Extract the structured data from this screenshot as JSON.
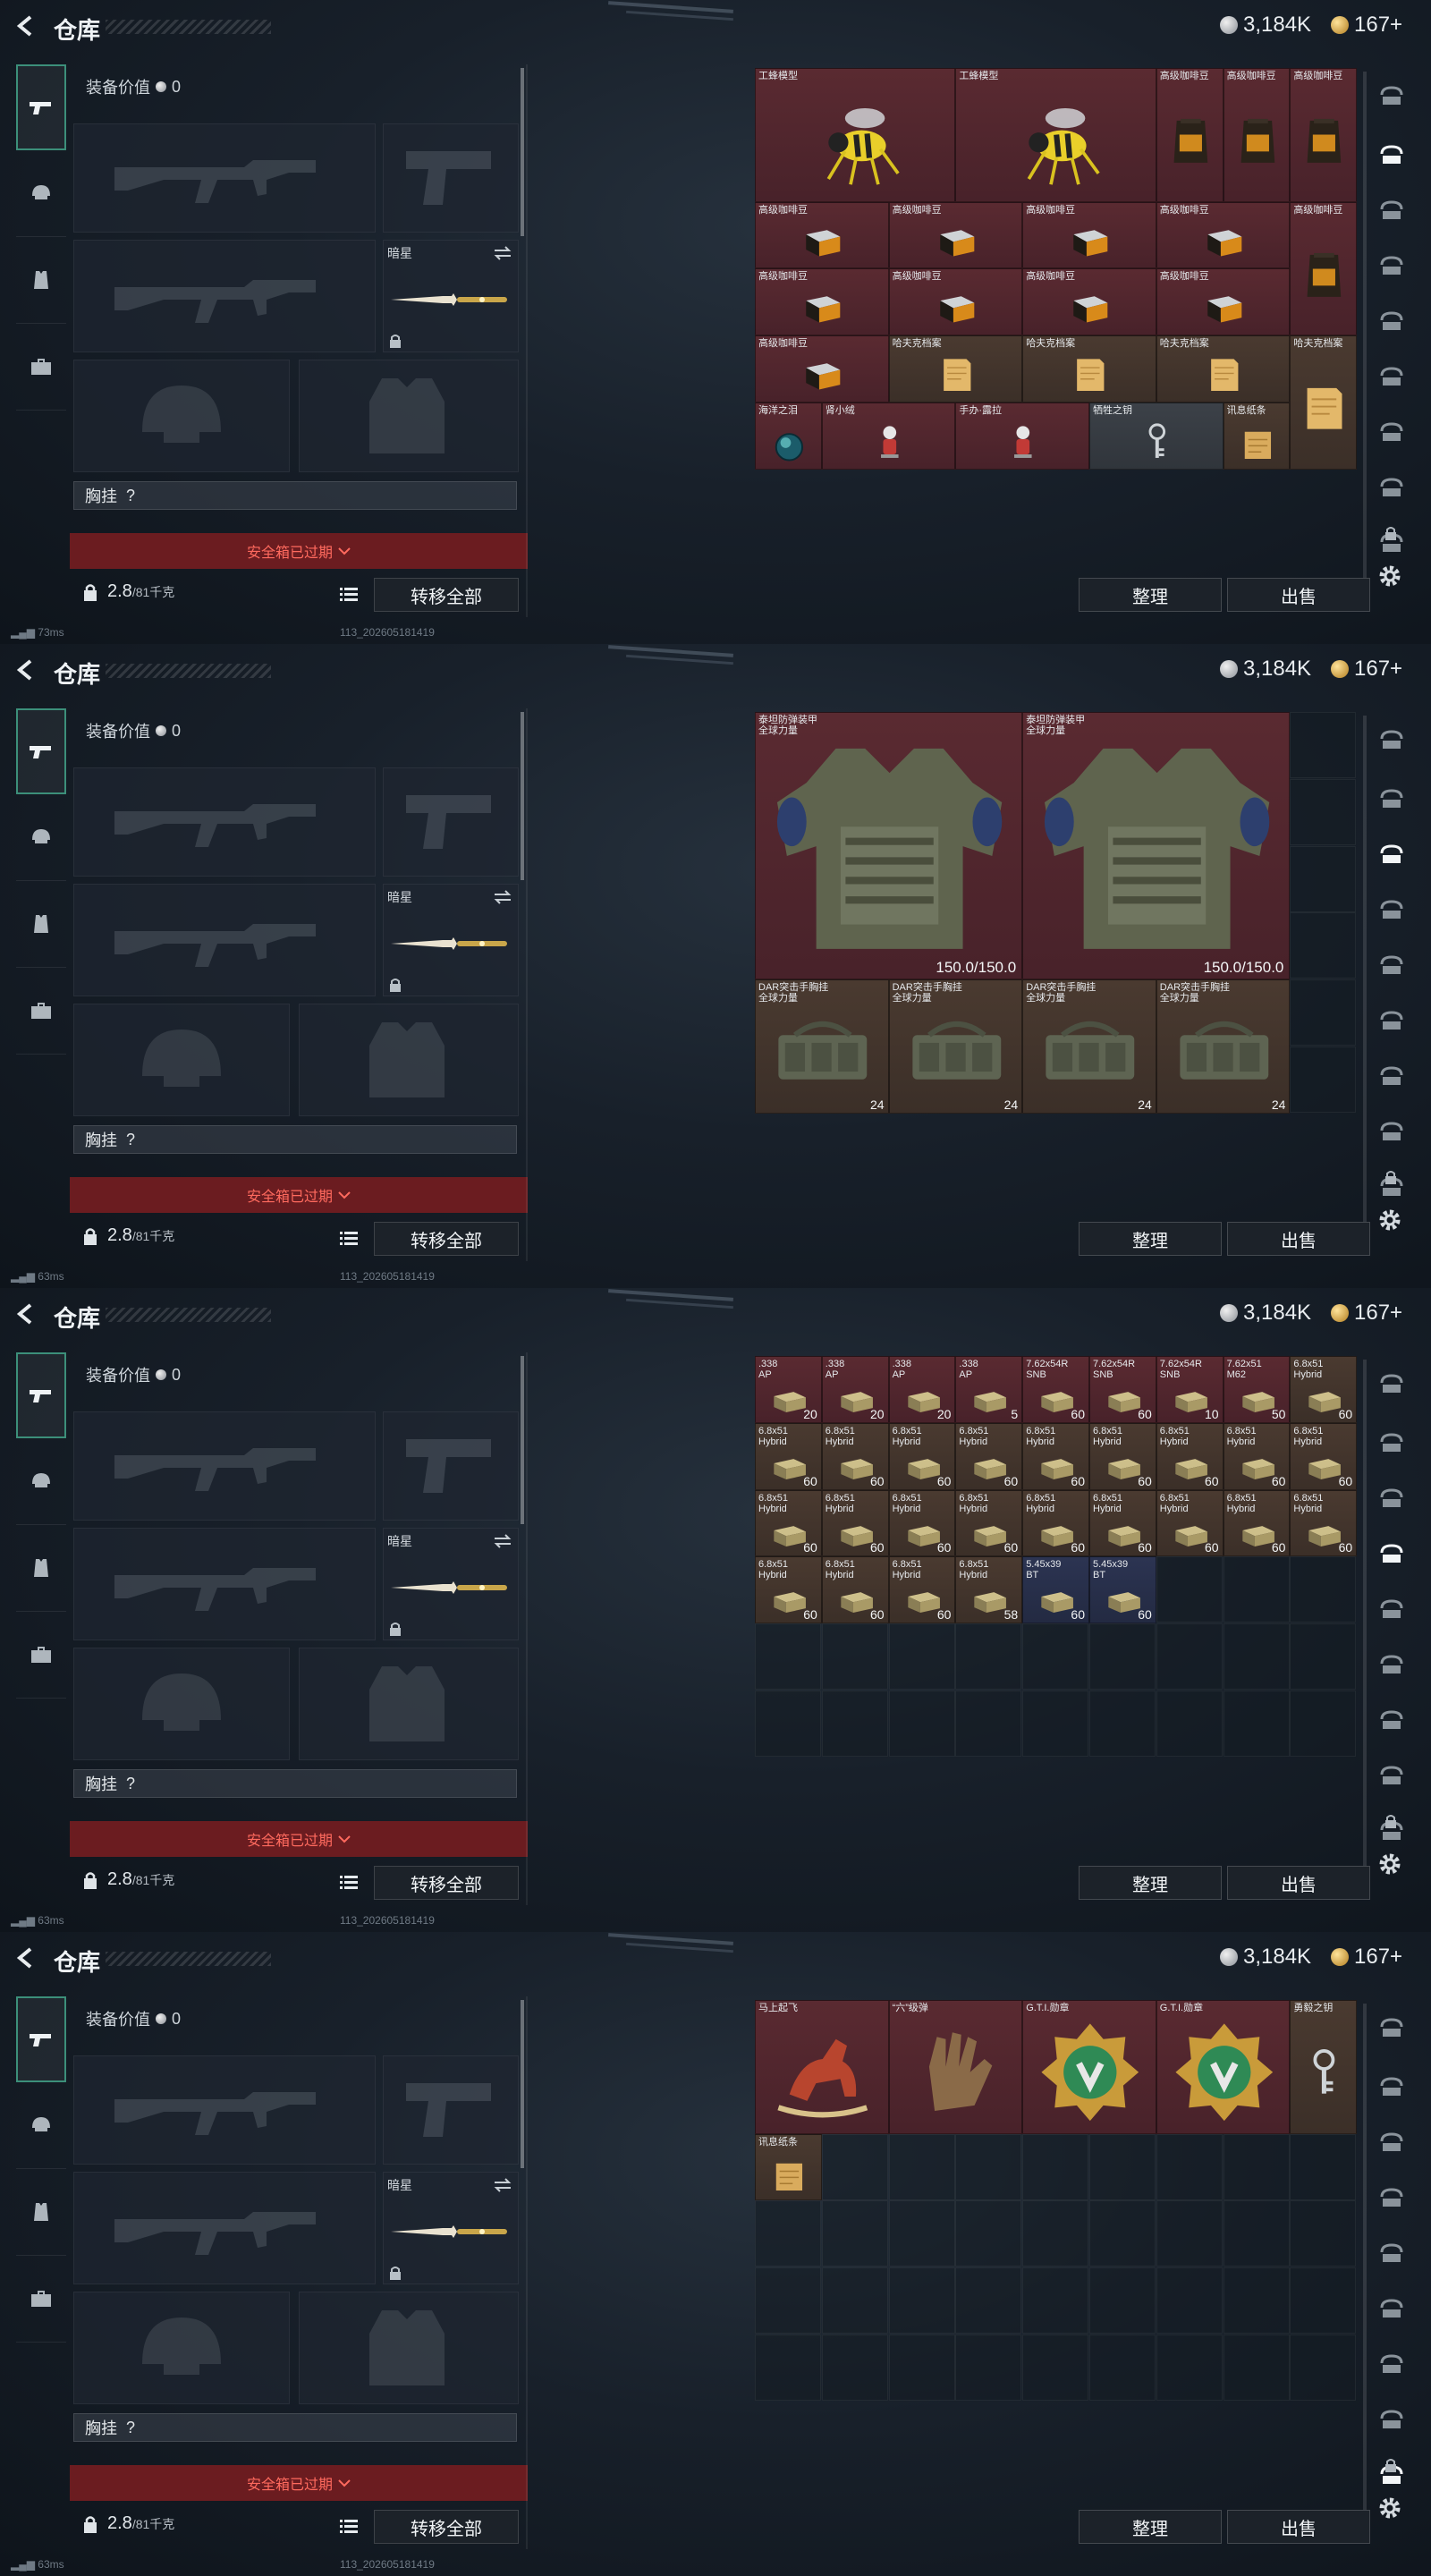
{
  "panels": [
    {
      "header": {
        "title": "仓库",
        "silver": "3,184K",
        "gold": "167+"
      },
      "equip": {
        "value_label": "装备价值",
        "value": "0",
        "secondary_slot_name": "暗星",
        "chest_label": "胸挂",
        "chest_hint": "?",
        "safebox_text": "安全箱已过期",
        "weight": "2.8",
        "weight_max": "/81千克",
        "transfer_label": "转移全部"
      },
      "status": {
        "ping": "73ms",
        "build": "113_202605181419"
      },
      "buttons": {
        "sort": "整理",
        "sell": "出售"
      }
    },
    {
      "header": {
        "title": "仓库",
        "silver": "3,184K",
        "gold": "167+"
      },
      "equip": {
        "value_label": "装备价值",
        "value": "0",
        "secondary_slot_name": "暗星",
        "chest_label": "胸挂",
        "chest_hint": "?",
        "safebox_text": "安全箱已过期",
        "weight": "2.8",
        "weight_max": "/81千克",
        "transfer_label": "转移全部"
      },
      "status": {
        "ping": "63ms",
        "build": "113_202605181419"
      },
      "buttons": {
        "sort": "整理",
        "sell": "出售"
      }
    },
    {
      "header": {
        "title": "仓库",
        "silver": "3,184K",
        "gold": "167+"
      },
      "equip": {
        "value_label": "装备价值",
        "value": "0",
        "secondary_slot_name": "暗星",
        "chest_label": "胸挂",
        "chest_hint": "?",
        "safebox_text": "安全箱已过期",
        "weight": "2.8",
        "weight_max": "/81千克",
        "transfer_label": "转移全部"
      },
      "status": {
        "ping": "63ms",
        "build": "113_202605181419"
      },
      "buttons": {
        "sort": "整理",
        "sell": "出售"
      }
    },
    {
      "header": {
        "title": "仓库",
        "silver": "3,184K",
        "gold": "167+"
      },
      "equip": {
        "value_label": "装备价值",
        "value": "0",
        "secondary_slot_name": "暗星",
        "chest_label": "胸挂",
        "chest_hint": "?",
        "safebox_text": "安全箱已过期",
        "weight": "2.8",
        "weight_max": "/81千克",
        "transfer_label": "转移全部"
      },
      "status": {
        "ping": "63ms",
        "build": "113_202605181419"
      },
      "buttons": {
        "sort": "整理",
        "sell": "出售"
      }
    }
  ],
  "storage": [
    {
      "items": [
        {
          "name": "工蜂模型",
          "r": 0,
          "c": 0,
          "w": 3,
          "h": 2,
          "bg": "red",
          "icon": "bee-model-icon"
        },
        {
          "name": "工蜂模型",
          "r": 0,
          "c": 3,
          "w": 3,
          "h": 2,
          "bg": "red",
          "icon": "bee-model-icon"
        },
        {
          "name": "高级咖啡豆",
          "r": 0,
          "c": 6,
          "w": 1,
          "h": 2,
          "bg": "red",
          "icon": "coffee-bag-icon"
        },
        {
          "name": "高级咖啡豆",
          "r": 0,
          "c": 7,
          "w": 1,
          "h": 2,
          "bg": "red",
          "icon": "coffee-bag-icon"
        },
        {
          "name": "高级咖啡豆",
          "r": 0,
          "c": 8,
          "w": 1,
          "h": 2,
          "bg": "red",
          "icon": "coffee-bag-icon"
        },
        {
          "name": "高级咖啡豆",
          "r": 2,
          "c": 0,
          "w": 2,
          "h": 1,
          "bg": "red",
          "icon": "coffee-box-icon"
        },
        {
          "name": "高级咖啡豆",
          "r": 2,
          "c": 2,
          "w": 2,
          "h": 1,
          "bg": "red",
          "icon": "coffee-box-icon"
        },
        {
          "name": "高级咖啡豆",
          "r": 2,
          "c": 4,
          "w": 2,
          "h": 1,
          "bg": "red",
          "icon": "coffee-box-icon"
        },
        {
          "name": "高级咖啡豆",
          "r": 2,
          "c": 6,
          "w": 2,
          "h": 1,
          "bg": "red",
          "icon": "coffee-box-icon"
        },
        {
          "name": "高级咖啡豆",
          "r": 2,
          "c": 8,
          "w": 1,
          "h": 2,
          "bg": "red",
          "icon": "coffee-bag-icon"
        },
        {
          "name": "高级咖啡豆",
          "r": 3,
          "c": 0,
          "w": 2,
          "h": 1,
          "bg": "red",
          "icon": "coffee-box-icon"
        },
        {
          "name": "高级咖啡豆",
          "r": 3,
          "c": 2,
          "w": 2,
          "h": 1,
          "bg": "red",
          "icon": "coffee-box-icon"
        },
        {
          "name": "高级咖啡豆",
          "r": 3,
          "c": 4,
          "w": 2,
          "h": 1,
          "bg": "red",
          "icon": "coffee-box-icon"
        },
        {
          "name": "高级咖啡豆",
          "r": 3,
          "c": 6,
          "w": 2,
          "h": 1,
          "bg": "red",
          "icon": "coffee-box-icon"
        },
        {
          "name": "高级咖啡豆",
          "r": 4,
          "c": 0,
          "w": 2,
          "h": 1,
          "bg": "red",
          "icon": "coffee-box-icon"
        },
        {
          "name": "哈夫克档案",
          "r": 4,
          "c": 2,
          "w": 2,
          "h": 1,
          "bg": "brown",
          "icon": "document-icon"
        },
        {
          "name": "哈夫克档案",
          "r": 4,
          "c": 4,
          "w": 2,
          "h": 1,
          "bg": "brown",
          "icon": "document-icon"
        },
        {
          "name": "哈夫克档案",
          "r": 4,
          "c": 6,
          "w": 2,
          "h": 1,
          "bg": "brown",
          "icon": "document-icon"
        },
        {
          "name": "哈夫克档案",
          "r": 4,
          "c": 8,
          "w": 1,
          "h": 2,
          "bg": "brown",
          "icon": "document-icon"
        },
        {
          "name": "海洋之泪",
          "r": 5,
          "c": 0,
          "w": 1,
          "h": 1,
          "bg": "red",
          "icon": "orb-icon"
        },
        {
          "name": "肾小绒",
          "r": 5,
          "c": 1,
          "w": 2,
          "h": 1,
          "bg": "red",
          "icon": "figure-icon"
        },
        {
          "name": "手办·露拉",
          "r": 5,
          "c": 3,
          "w": 2,
          "h": 1,
          "bg": "red",
          "icon": "figure-icon"
        },
        {
          "name": "牺牲之钥",
          "r": 5,
          "c": 5,
          "w": 2,
          "h": 1,
          "bg": "gray",
          "icon": "key-icon"
        },
        {
          "name": "讯息纸条",
          "r": 5,
          "c": 7,
          "w": 1,
          "h": 1,
          "bg": "brown",
          "icon": "note-icon"
        }
      ]
    },
    {
      "items": [
        {
          "name": "泰坦防弹装甲\n全球力量",
          "r": 0,
          "c": 0,
          "w": 4,
          "h": 4,
          "bg": "red",
          "icon": "armor-icon",
          "durability": "150.0/150.0"
        },
        {
          "name": "泰坦防弹装甲\n全球力量",
          "r": 0,
          "c": 4,
          "w": 4,
          "h": 4,
          "bg": "red",
          "icon": "armor-icon",
          "durability": "150.0/150.0"
        },
        {
          "name": "DAR突击手胸挂\n全球力量",
          "r": 4,
          "c": 0,
          "w": 2,
          "h": 2,
          "bg": "brown",
          "icon": "chest-rig-icon",
          "count": "24"
        },
        {
          "name": "DAR突击手胸挂\n全球力量",
          "r": 4,
          "c": 2,
          "w": 2,
          "h": 2,
          "bg": "brown",
          "icon": "chest-rig-icon",
          "count": "24"
        },
        {
          "name": "DAR突击手胸挂\n全球力量",
          "r": 4,
          "c": 4,
          "w": 2,
          "h": 2,
          "bg": "brown",
          "icon": "chest-rig-icon",
          "count": "24"
        },
        {
          "name": "DAR突击手胸挂\n全球力量",
          "r": 4,
          "c": 6,
          "w": 2,
          "h": 2,
          "bg": "brown",
          "icon": "chest-rig-icon",
          "count": "24"
        }
      ]
    },
    {
      "items": [
        {
          "name": ".338\nAP",
          "r": 0,
          "c": 0,
          "w": 1,
          "h": 1,
          "bg": "red",
          "icon": "ammo-box-icon",
          "count": "20"
        },
        {
          "name": ".338\nAP",
          "r": 0,
          "c": 1,
          "w": 1,
          "h": 1,
          "bg": "red",
          "icon": "ammo-box-icon",
          "count": "20"
        },
        {
          "name": ".338\nAP",
          "r": 0,
          "c": 2,
          "w": 1,
          "h": 1,
          "bg": "red",
          "icon": "ammo-box-icon",
          "count": "20"
        },
        {
          "name": ".338\nAP",
          "r": 0,
          "c": 3,
          "w": 1,
          "h": 1,
          "bg": "red",
          "icon": "ammo-box-icon",
          "count": "5"
        },
        {
          "name": "7.62x54R\nSNB",
          "r": 0,
          "c": 4,
          "w": 1,
          "h": 1,
          "bg": "red",
          "icon": "ammo-box-icon",
          "count": "60"
        },
        {
          "name": "7.62x54R\nSNB",
          "r": 0,
          "c": 5,
          "w": 1,
          "h": 1,
          "bg": "red",
          "icon": "ammo-box-icon",
          "count": "60"
        },
        {
          "name": "7.62x54R\nSNB",
          "r": 0,
          "c": 6,
          "w": 1,
          "h": 1,
          "bg": "red",
          "icon": "ammo-box-icon",
          "count": "10"
        },
        {
          "name": "7.62x51\nM62",
          "r": 0,
          "c": 7,
          "w": 1,
          "h": 1,
          "bg": "red",
          "icon": "ammo-box-icon",
          "count": "50"
        },
        {
          "name": "6.8x51\nHybrid",
          "r": 0,
          "c": 8,
          "w": 1,
          "h": 1,
          "bg": "brown",
          "icon": "ammo-box-icon",
          "count": "60"
        },
        {
          "name": "6.8x51\nHybrid",
          "r": 1,
          "c": 0,
          "w": 1,
          "h": 1,
          "bg": "brown",
          "icon": "ammo-box-icon",
          "count": "60"
        },
        {
          "name": "6.8x51\nHybrid",
          "r": 1,
          "c": 1,
          "w": 1,
          "h": 1,
          "bg": "brown",
          "icon": "ammo-box-icon",
          "count": "60"
        },
        {
          "name": "6.8x51\nHybrid",
          "r": 1,
          "c": 2,
          "w": 1,
          "h": 1,
          "bg": "brown",
          "icon": "ammo-box-icon",
          "count": "60"
        },
        {
          "name": "6.8x51\nHybrid",
          "r": 1,
          "c": 3,
          "w": 1,
          "h": 1,
          "bg": "brown",
          "icon": "ammo-box-icon",
          "count": "60"
        },
        {
          "name": "6.8x51\nHybrid",
          "r": 1,
          "c": 4,
          "w": 1,
          "h": 1,
          "bg": "brown",
          "icon": "ammo-box-icon",
          "count": "60"
        },
        {
          "name": "6.8x51\nHybrid",
          "r": 1,
          "c": 5,
          "w": 1,
          "h": 1,
          "bg": "brown",
          "icon": "ammo-box-icon",
          "count": "60"
        },
        {
          "name": "6.8x51\nHybrid",
          "r": 1,
          "c": 6,
          "w": 1,
          "h": 1,
          "bg": "brown",
          "icon": "ammo-box-icon",
          "count": "60"
        },
        {
          "name": "6.8x51\nHybrid",
          "r": 1,
          "c": 7,
          "w": 1,
          "h": 1,
          "bg": "brown",
          "icon": "ammo-box-icon",
          "count": "60"
        },
        {
          "name": "6.8x51\nHybrid",
          "r": 1,
          "c": 8,
          "w": 1,
          "h": 1,
          "bg": "brown",
          "icon": "ammo-box-icon",
          "count": "60"
        },
        {
          "name": "6.8x51\nHybrid",
          "r": 2,
          "c": 0,
          "w": 1,
          "h": 1,
          "bg": "brown",
          "icon": "ammo-box-icon",
          "count": "60"
        },
        {
          "name": "6.8x51\nHybrid",
          "r": 2,
          "c": 1,
          "w": 1,
          "h": 1,
          "bg": "brown",
          "icon": "ammo-box-icon",
          "count": "60"
        },
        {
          "name": "6.8x51\nHybrid",
          "r": 2,
          "c": 2,
          "w": 1,
          "h": 1,
          "bg": "brown",
          "icon": "ammo-box-icon",
          "count": "60"
        },
        {
          "name": "6.8x51\nHybrid",
          "r": 2,
          "c": 3,
          "w": 1,
          "h": 1,
          "bg": "brown",
          "icon": "ammo-box-icon",
          "count": "60"
        },
        {
          "name": "6.8x51\nHybrid",
          "r": 2,
          "c": 4,
          "w": 1,
          "h": 1,
          "bg": "brown",
          "icon": "ammo-box-icon",
          "count": "60"
        },
        {
          "name": "6.8x51\nHybrid",
          "r": 2,
          "c": 5,
          "w": 1,
          "h": 1,
          "bg": "brown",
          "icon": "ammo-box-icon",
          "count": "60"
        },
        {
          "name": "6.8x51\nHybrid",
          "r": 2,
          "c": 6,
          "w": 1,
          "h": 1,
          "bg": "brown",
          "icon": "ammo-box-icon",
          "count": "60"
        },
        {
          "name": "6.8x51\nHybrid",
          "r": 2,
          "c": 7,
          "w": 1,
          "h": 1,
          "bg": "brown",
          "icon": "ammo-box-icon",
          "count": "60"
        },
        {
          "name": "6.8x51\nHybrid",
          "r": 2,
          "c": 8,
          "w": 1,
          "h": 1,
          "bg": "brown",
          "icon": "ammo-box-icon",
          "count": "60"
        },
        {
          "name": "6.8x51\nHybrid",
          "r": 3,
          "c": 0,
          "w": 1,
          "h": 1,
          "bg": "brown",
          "icon": "ammo-box-icon",
          "count": "60"
        },
        {
          "name": "6.8x51\nHybrid",
          "r": 3,
          "c": 1,
          "w": 1,
          "h": 1,
          "bg": "brown",
          "icon": "ammo-box-icon",
          "count": "60"
        },
        {
          "name": "6.8x51\nHybrid",
          "r": 3,
          "c": 2,
          "w": 1,
          "h": 1,
          "bg": "brown",
          "icon": "ammo-box-icon",
          "count": "60"
        },
        {
          "name": "6.8x51\nHybrid",
          "r": 3,
          "c": 3,
          "w": 1,
          "h": 1,
          "bg": "brown",
          "icon": "ammo-box-icon",
          "count": "58"
        },
        {
          "name": "5.45x39\nBT",
          "r": 3,
          "c": 4,
          "w": 1,
          "h": 1,
          "bg": "blue",
          "icon": "ammo-box-icon",
          "count": "60"
        },
        {
          "name": "5.45x39\nBT",
          "r": 3,
          "c": 5,
          "w": 1,
          "h": 1,
          "bg": "blue",
          "icon": "ammo-box-icon",
          "count": "60"
        }
      ]
    },
    {
      "items": [
        {
          "name": "马上起飞",
          "r": 0,
          "c": 0,
          "w": 2,
          "h": 2,
          "bg": "red",
          "icon": "horse-statue-icon"
        },
        {
          "name": "“六”级弹",
          "r": 0,
          "c": 2,
          "w": 2,
          "h": 2,
          "bg": "red",
          "icon": "glove-icon"
        },
        {
          "name": "G.T.I.勋章",
          "r": 0,
          "c": 4,
          "w": 2,
          "h": 2,
          "bg": "red",
          "icon": "medal-icon"
        },
        {
          "name": "G.T.I.勋章",
          "r": 0,
          "c": 6,
          "w": 2,
          "h": 2,
          "bg": "red",
          "icon": "medal-icon"
        },
        {
          "name": "勇毅之钥",
          "r": 0,
          "c": 8,
          "w": 1,
          "h": 2,
          "bg": "brown",
          "icon": "key-icon"
        },
        {
          "name": "讯息纸条",
          "r": 2,
          "c": 0,
          "w": 1,
          "h": 1,
          "bg": "brown",
          "icon": "note-icon"
        }
      ]
    }
  ],
  "right_tabs_active": [
    1,
    2,
    3,
    8
  ],
  "colors": {
    "accent_green": "#3c8f7a",
    "safebox_red": "#6b1c20",
    "rare_red": "#5a2a31"
  }
}
